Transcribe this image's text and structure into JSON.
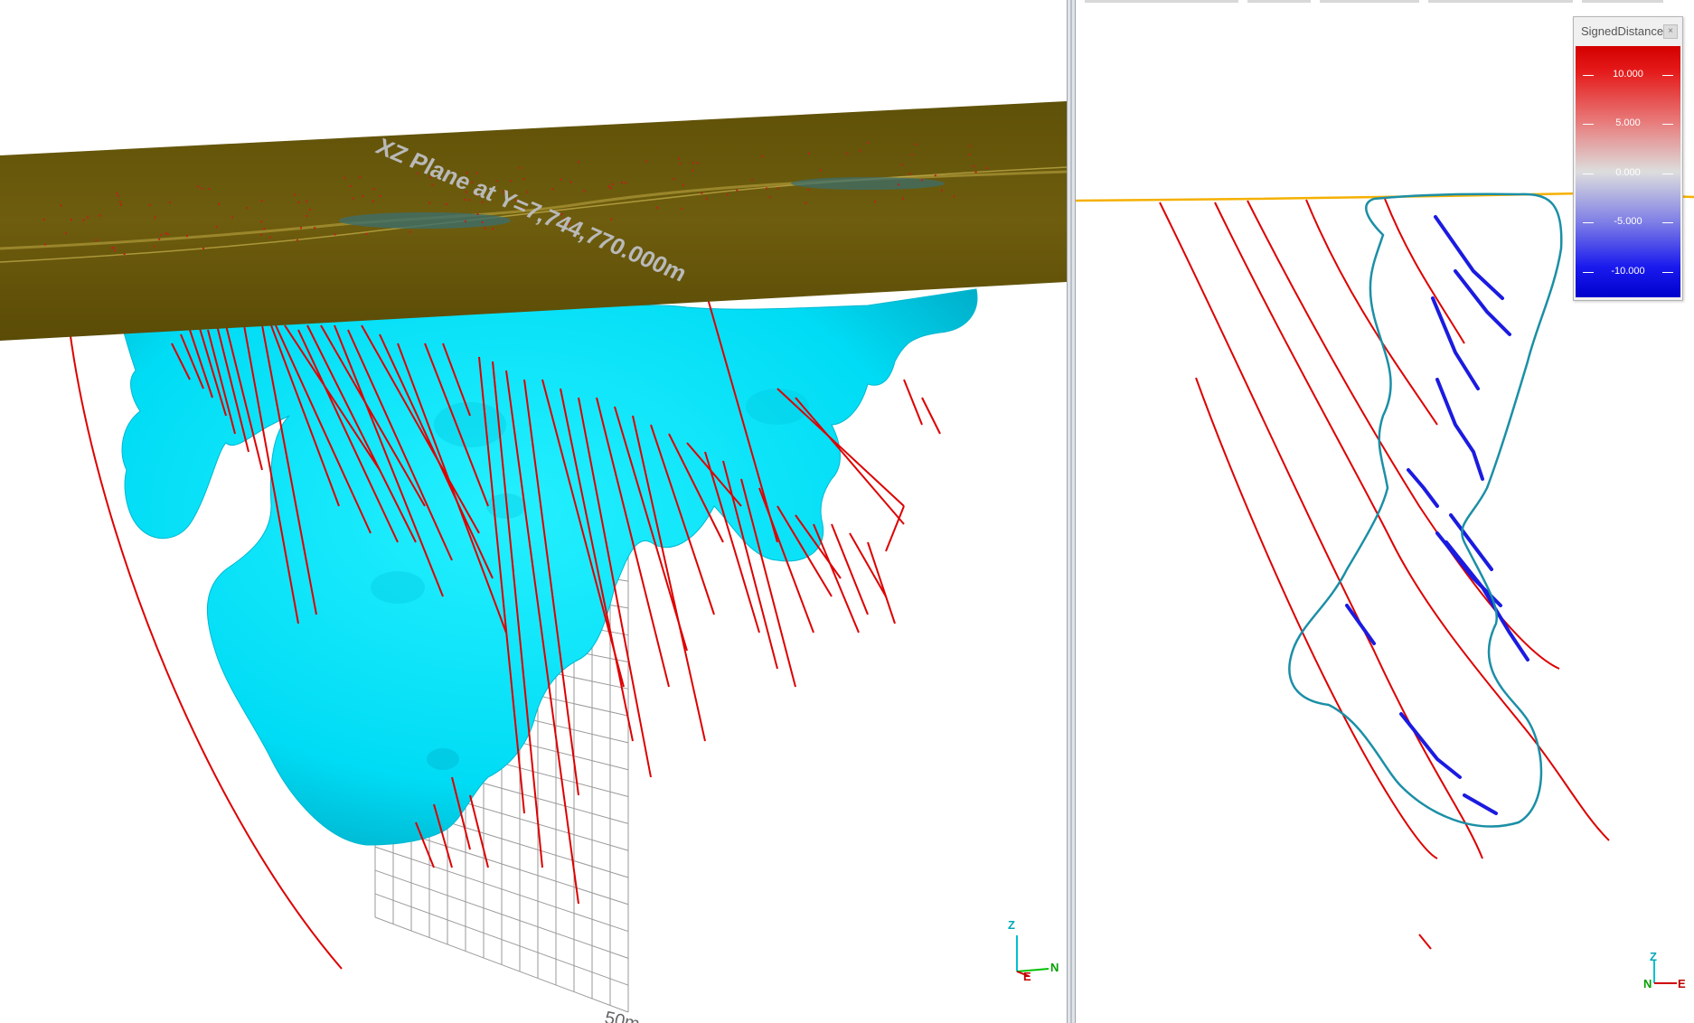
{
  "left_view": {
    "plane_label": "XZ Plane at Y=7,744,770.000m",
    "scale_label": "50m",
    "axis": {
      "z": "Z",
      "n": "N",
      "e": "E"
    }
  },
  "right_view": {
    "legend": {
      "title": "SignedDistance",
      "close_label": "×",
      "ticks": [
        "10.000",
        "5.000",
        "0.000",
        "-5.000",
        "-10.000"
      ]
    },
    "axis": {
      "z": "Z",
      "n": "N",
      "e": "E"
    }
  },
  "colors": {
    "body": "#00e5ff",
    "plane": "#6b5a0c",
    "drillhole": "#dd0000",
    "outline": "#1b8fa6",
    "surface_line": "#f5b000",
    "inside_trace": "#1b1be0"
  }
}
